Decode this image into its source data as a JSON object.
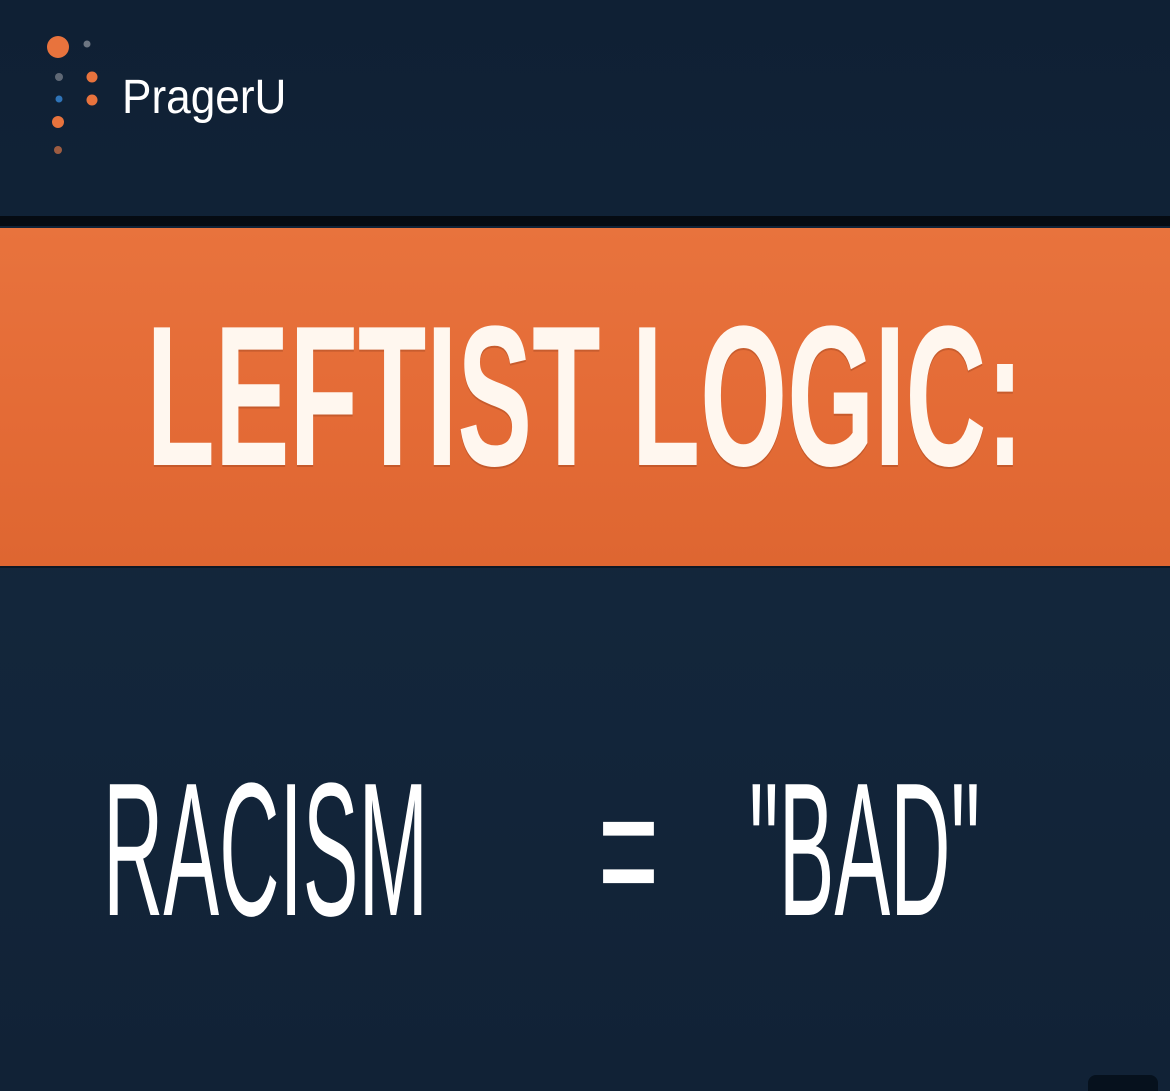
{
  "logo": {
    "text": "PragerU"
  },
  "banner": {
    "title": "LEFTIST LOGIC:"
  },
  "equation": {
    "left": "RACISM",
    "operator": "=",
    "right": "\"BAD\""
  },
  "colors": {
    "background": "#112236",
    "banner": "#e46b36",
    "text": "#ffffff",
    "logo_accent": "#e8733d"
  },
  "icons": {
    "logo_mark": "dot-cluster-icon"
  }
}
